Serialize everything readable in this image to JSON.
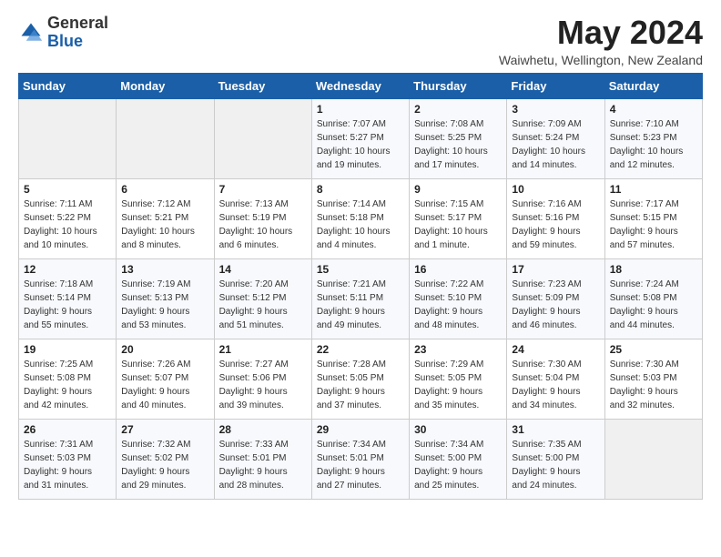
{
  "logo": {
    "general": "General",
    "blue": "Blue"
  },
  "header": {
    "month_title": "May 2024",
    "subtitle": "Waiwhetu, Wellington, New Zealand"
  },
  "weekdays": [
    "Sunday",
    "Monday",
    "Tuesday",
    "Wednesday",
    "Thursday",
    "Friday",
    "Saturday"
  ],
  "weeks": [
    [
      {
        "day": "",
        "info": ""
      },
      {
        "day": "",
        "info": ""
      },
      {
        "day": "",
        "info": ""
      },
      {
        "day": "1",
        "info": "Sunrise: 7:07 AM\nSunset: 5:27 PM\nDaylight: 10 hours\nand 19 minutes."
      },
      {
        "day": "2",
        "info": "Sunrise: 7:08 AM\nSunset: 5:25 PM\nDaylight: 10 hours\nand 17 minutes."
      },
      {
        "day": "3",
        "info": "Sunrise: 7:09 AM\nSunset: 5:24 PM\nDaylight: 10 hours\nand 14 minutes."
      },
      {
        "day": "4",
        "info": "Sunrise: 7:10 AM\nSunset: 5:23 PM\nDaylight: 10 hours\nand 12 minutes."
      }
    ],
    [
      {
        "day": "5",
        "info": "Sunrise: 7:11 AM\nSunset: 5:22 PM\nDaylight: 10 hours\nand 10 minutes."
      },
      {
        "day": "6",
        "info": "Sunrise: 7:12 AM\nSunset: 5:21 PM\nDaylight: 10 hours\nand 8 minutes."
      },
      {
        "day": "7",
        "info": "Sunrise: 7:13 AM\nSunset: 5:19 PM\nDaylight: 10 hours\nand 6 minutes."
      },
      {
        "day": "8",
        "info": "Sunrise: 7:14 AM\nSunset: 5:18 PM\nDaylight: 10 hours\nand 4 minutes."
      },
      {
        "day": "9",
        "info": "Sunrise: 7:15 AM\nSunset: 5:17 PM\nDaylight: 10 hours\nand 1 minute."
      },
      {
        "day": "10",
        "info": "Sunrise: 7:16 AM\nSunset: 5:16 PM\nDaylight: 9 hours\nand 59 minutes."
      },
      {
        "day": "11",
        "info": "Sunrise: 7:17 AM\nSunset: 5:15 PM\nDaylight: 9 hours\nand 57 minutes."
      }
    ],
    [
      {
        "day": "12",
        "info": "Sunrise: 7:18 AM\nSunset: 5:14 PM\nDaylight: 9 hours\nand 55 minutes."
      },
      {
        "day": "13",
        "info": "Sunrise: 7:19 AM\nSunset: 5:13 PM\nDaylight: 9 hours\nand 53 minutes."
      },
      {
        "day": "14",
        "info": "Sunrise: 7:20 AM\nSunset: 5:12 PM\nDaylight: 9 hours\nand 51 minutes."
      },
      {
        "day": "15",
        "info": "Sunrise: 7:21 AM\nSunset: 5:11 PM\nDaylight: 9 hours\nand 49 minutes."
      },
      {
        "day": "16",
        "info": "Sunrise: 7:22 AM\nSunset: 5:10 PM\nDaylight: 9 hours\nand 48 minutes."
      },
      {
        "day": "17",
        "info": "Sunrise: 7:23 AM\nSunset: 5:09 PM\nDaylight: 9 hours\nand 46 minutes."
      },
      {
        "day": "18",
        "info": "Sunrise: 7:24 AM\nSunset: 5:08 PM\nDaylight: 9 hours\nand 44 minutes."
      }
    ],
    [
      {
        "day": "19",
        "info": "Sunrise: 7:25 AM\nSunset: 5:08 PM\nDaylight: 9 hours\nand 42 minutes."
      },
      {
        "day": "20",
        "info": "Sunrise: 7:26 AM\nSunset: 5:07 PM\nDaylight: 9 hours\nand 40 minutes."
      },
      {
        "day": "21",
        "info": "Sunrise: 7:27 AM\nSunset: 5:06 PM\nDaylight: 9 hours\nand 39 minutes."
      },
      {
        "day": "22",
        "info": "Sunrise: 7:28 AM\nSunset: 5:05 PM\nDaylight: 9 hours\nand 37 minutes."
      },
      {
        "day": "23",
        "info": "Sunrise: 7:29 AM\nSunset: 5:05 PM\nDaylight: 9 hours\nand 35 minutes."
      },
      {
        "day": "24",
        "info": "Sunrise: 7:30 AM\nSunset: 5:04 PM\nDaylight: 9 hours\nand 34 minutes."
      },
      {
        "day": "25",
        "info": "Sunrise: 7:30 AM\nSunset: 5:03 PM\nDaylight: 9 hours\nand 32 minutes."
      }
    ],
    [
      {
        "day": "26",
        "info": "Sunrise: 7:31 AM\nSunset: 5:03 PM\nDaylight: 9 hours\nand 31 minutes."
      },
      {
        "day": "27",
        "info": "Sunrise: 7:32 AM\nSunset: 5:02 PM\nDaylight: 9 hours\nand 29 minutes."
      },
      {
        "day": "28",
        "info": "Sunrise: 7:33 AM\nSunset: 5:01 PM\nDaylight: 9 hours\nand 28 minutes."
      },
      {
        "day": "29",
        "info": "Sunrise: 7:34 AM\nSunset: 5:01 PM\nDaylight: 9 hours\nand 27 minutes."
      },
      {
        "day": "30",
        "info": "Sunrise: 7:34 AM\nSunset: 5:00 PM\nDaylight: 9 hours\nand 25 minutes."
      },
      {
        "day": "31",
        "info": "Sunrise: 7:35 AM\nSunset: 5:00 PM\nDaylight: 9 hours\nand 24 minutes."
      },
      {
        "day": "",
        "info": ""
      }
    ]
  ]
}
